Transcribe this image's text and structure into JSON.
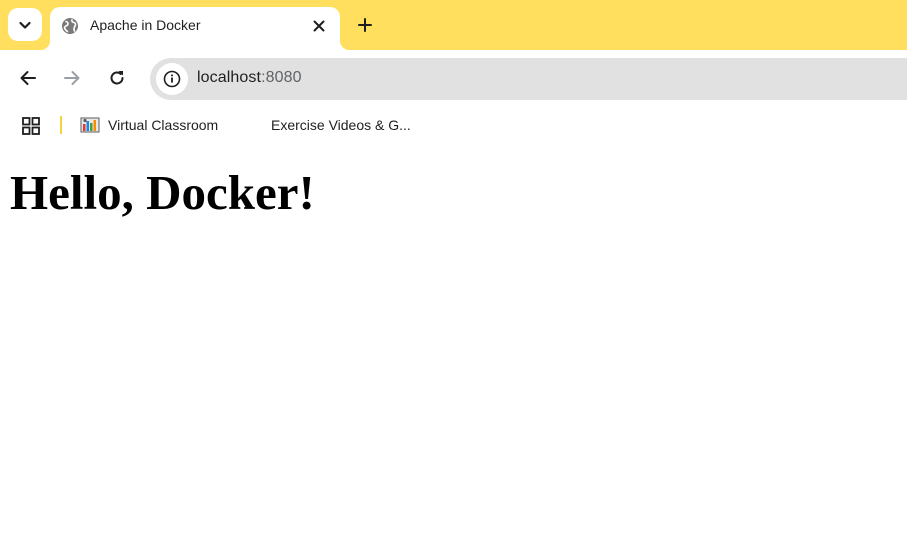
{
  "browser": {
    "theme_color": "#ffdf5d",
    "tab": {
      "title": "Apache in Docker",
      "favicon": "globe-icon"
    },
    "address_bar": {
      "host": "localhost",
      "port": ":8080",
      "site_info_icon": "info-icon"
    },
    "nav": {
      "back_icon": "back-arrow-icon",
      "forward_icon": "forward-arrow-icon",
      "reload_icon": "reload-icon"
    },
    "bookmarks": [
      {
        "label": "Virtual Classroom",
        "icon": "classroom-icon"
      },
      {
        "label": "Exercise Videos & G...",
        "icon": ""
      }
    ]
  },
  "page": {
    "heading": "Hello, Docker!"
  }
}
